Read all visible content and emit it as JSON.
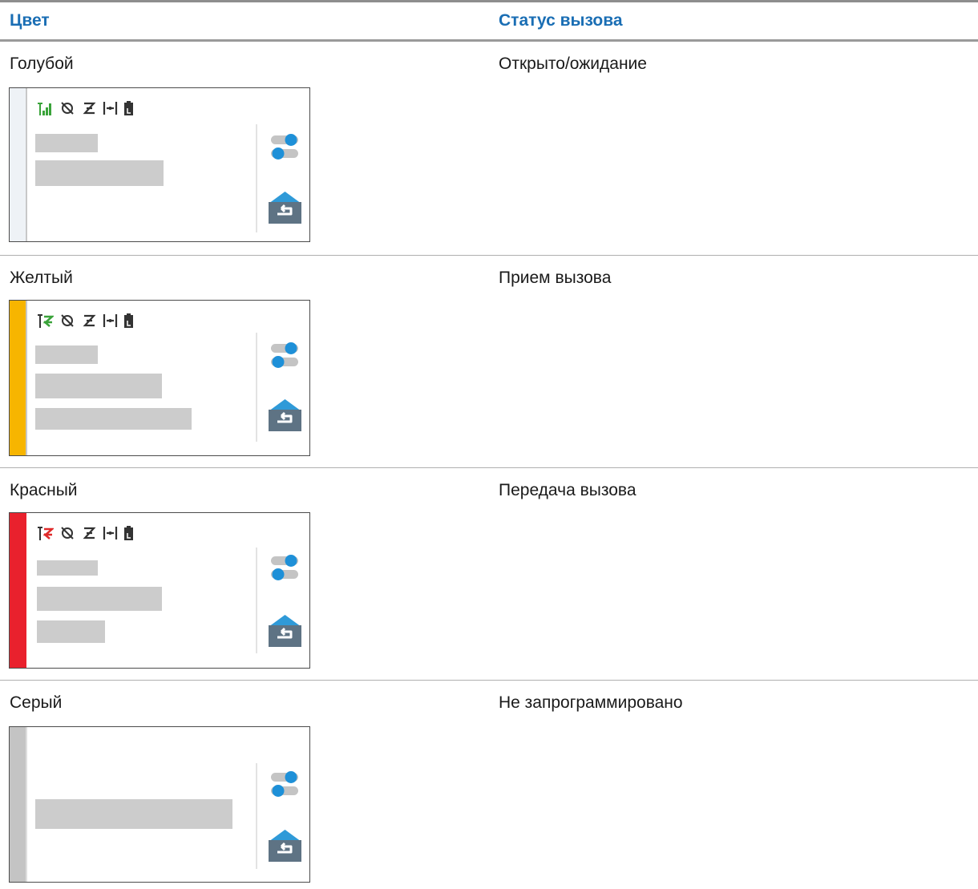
{
  "table": {
    "headers": {
      "color": "Цвет",
      "status": "Статус вызова"
    },
    "rows": [
      {
        "color_name": "Голубой",
        "status": "Открыто/ожидание",
        "stripe_color": "#eef2f6",
        "signal_indicator": "signal-bars-icon"
      },
      {
        "color_name": "Желтый",
        "status": "Прием вызова",
        "stripe_color": "#f7b500",
        "signal_indicator": "receive-arrows-icon"
      },
      {
        "color_name": "Красный",
        "status": "Передача вызова",
        "stripe_color": "#e9212d",
        "signal_indicator": "transmit-arrows-icon"
      },
      {
        "color_name": "Серый",
        "status": "Не запрограммировано",
        "stripe_color": "#c4c4c4",
        "signal_indicator": "none"
      }
    ]
  },
  "colors": {
    "header_text": "#1a6eb4",
    "placeholder_bar": "#cccccc",
    "toggle_blue": "#1e90d8",
    "home_icon_blue": "#2f9ad8",
    "home_icon_slate": "#5e7384"
  }
}
